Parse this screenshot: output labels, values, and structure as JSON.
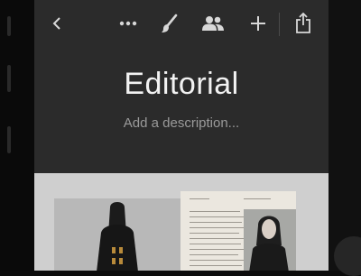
{
  "toolbar": {
    "back_icon": "chevron-left-icon",
    "more_icon": "ellipsis-icon",
    "brush_icon": "brush-icon",
    "people_icon": "people-icon",
    "add_icon": "plus-icon",
    "share_icon": "share-icon"
  },
  "board": {
    "title": "Editorial",
    "description_placeholder": "Add a description..."
  },
  "colors": {
    "screen_bg": "#2b2b2b",
    "icon": "#d8d8d8",
    "title": "#f2f2f2",
    "placeholder": "#9a9a9a"
  }
}
